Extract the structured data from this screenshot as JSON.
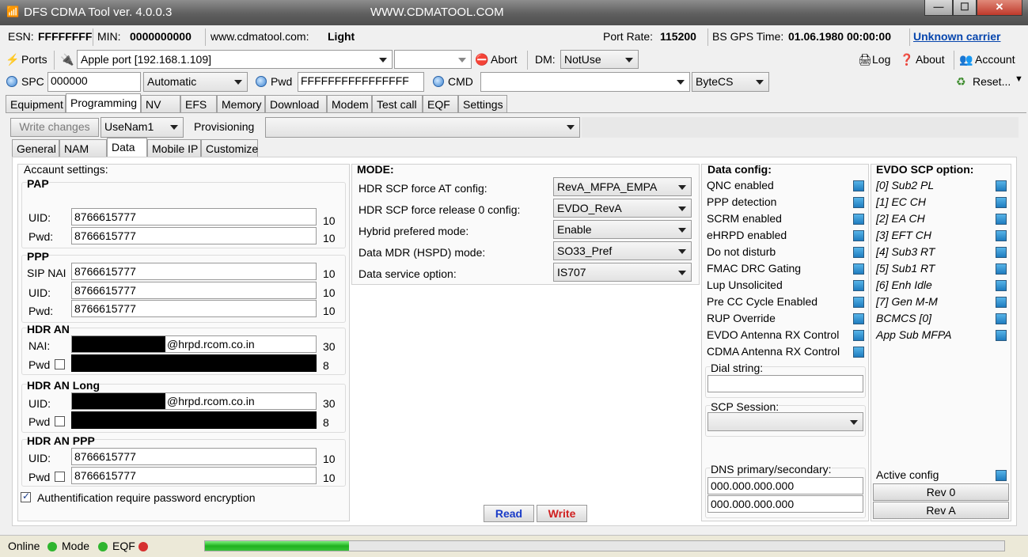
{
  "window": {
    "title": "DFS CDMA Tool ver. 4.0.0.3",
    "site": "WWW.CDMATOOL.COM",
    "min": "—",
    "max": "☐",
    "close": "✕"
  },
  "info": {
    "esn_label": "ESN:",
    "esn": "FFFFFFFF",
    "min_label": "MIN:",
    "min": "0000000000",
    "site_label": "www.cdmatool.com:",
    "edition": "Light",
    "port_rate_label": "Port Rate:",
    "port_rate": "115200",
    "gps_label": "BS GPS Time:",
    "gps": "01.06.1980 00:00:00",
    "carrier": "Unknown carrier"
  },
  "toolbar1": {
    "ports": "Ports",
    "port": "Apple port [192.168.1.109]",
    "abort": "Abort",
    "dm_label": "DM:",
    "dm": "NotUse",
    "log": "Log",
    "about": "About",
    "account": "Account"
  },
  "toolbar2": {
    "spc_label": "SPC",
    "spc": "000000",
    "mode": "Automatic",
    "pwd_label": "Pwd",
    "pwd": "FFFFFFFFFFFFFFFF",
    "cmd_label": "CMD",
    "cmd": "",
    "bytecs": "ByteCS",
    "reset": "Reset..."
  },
  "main_tabs": [
    "Equipment",
    "Programming",
    "NV",
    "EFS",
    "Memory",
    "Download",
    "Modem",
    "Test call",
    "EQF",
    "Settings"
  ],
  "prog_bar": {
    "write_changes": "Write changes",
    "nam": "UseNam1",
    "provisioning_label": "Provisioning",
    "provisioning": ""
  },
  "sub_tabs": [
    "General",
    "NAM",
    "Data",
    "Mobile IP",
    "Customize"
  ],
  "account": {
    "title": "Accaunt settings:",
    "pap": {
      "title": "PAP",
      "uid_label": "UID:",
      "uid": "8766615777",
      "uid_len": "10",
      "pwd_label": "Pwd:",
      "pwd": "8766615777",
      "pwd_len": "10"
    },
    "ppp": {
      "title": "PPP",
      "sip_label": "SIP NAI",
      "sip": "8766615777",
      "sip_len": "10",
      "uid_label": "UID:",
      "uid": "8766615777",
      "uid_len": "10",
      "pwd_label": "Pwd:",
      "pwd": "8766615777",
      "pwd_len": "10"
    },
    "hdr_an": {
      "title": "HDR AN",
      "nai_label": "NAI:",
      "nai_suffix": "@hrpd.rcom.co.in",
      "nai_len": "30",
      "pwd_label": "Pwd",
      "pwd_len": "8"
    },
    "hdr_an_long": {
      "title": "HDR AN Long",
      "uid_label": "UID:",
      "uid_suffix": "@hrpd.rcom.co.in",
      "uid_len": "30",
      "pwd_label": "Pwd",
      "pwd_len": "8"
    },
    "hdr_an_ppp": {
      "title": "HDR AN PPP",
      "uid_label": "UID:",
      "uid": "8766615777",
      "uid_len": "10",
      "pwd_label": "Pwd",
      "pwd": "8766615777",
      "pwd_len": "10"
    },
    "auth_label": "Authentification require password encryption"
  },
  "mode": {
    "title": "MODE:",
    "rows": [
      {
        "label": "HDR SCP force AT config:",
        "value": "RevA_MFPA_EMPA"
      },
      {
        "label": "HDR SCP force release 0 config:",
        "value": "EVDO_RevA"
      },
      {
        "label": "Hybrid prefered mode:",
        "value": "Enable"
      },
      {
        "label": "Data MDR (HSPD) mode:",
        "value": "SO33_Pref"
      },
      {
        "label": "Data service option:",
        "value": "IS707"
      }
    ]
  },
  "buttons": {
    "read": "Read",
    "write": "Write"
  },
  "data_config": {
    "title": "Data config:",
    "items": [
      "QNC enabled",
      "PPP detection",
      "SCRM enabled",
      "eHRPD enabled",
      "Do not disturb",
      "FMAC DRC Gating",
      "Lup Unsolicited",
      "Pre CC Cycle Enabled",
      "RUP Override",
      "EVDO Antenna RX Control",
      "CDMA Antenna RX Control"
    ],
    "dial_label": "Dial string:",
    "dial": "",
    "scp_label": "SCP Session:",
    "scp": "",
    "dns_label": "DNS primary/secondary:",
    "dns1": "000.000.000.000",
    "dns2": "000.000.000.000"
  },
  "evdo": {
    "title": "EVDO SCP option:",
    "items": [
      "[0] Sub2 PL",
      "[1] EC CH",
      "[2] EA CH",
      "[3] EFT CH",
      "[4] Sub3 RT",
      "[5] Sub1 RT",
      "[6] Enh Idle",
      "[7] Gen M-M",
      "BCMCS [0]",
      "App Sub MFPA"
    ],
    "active_label": "Active config",
    "rev0": "Rev 0",
    "reva": "Rev A"
  },
  "status": {
    "online": "Online",
    "mode": "Mode",
    "eqf": "EQF",
    "progress": 0.18,
    "online_color": "#2fb52f",
    "mode_color": "#2fb52f",
    "eqf_color": "#d63030"
  }
}
